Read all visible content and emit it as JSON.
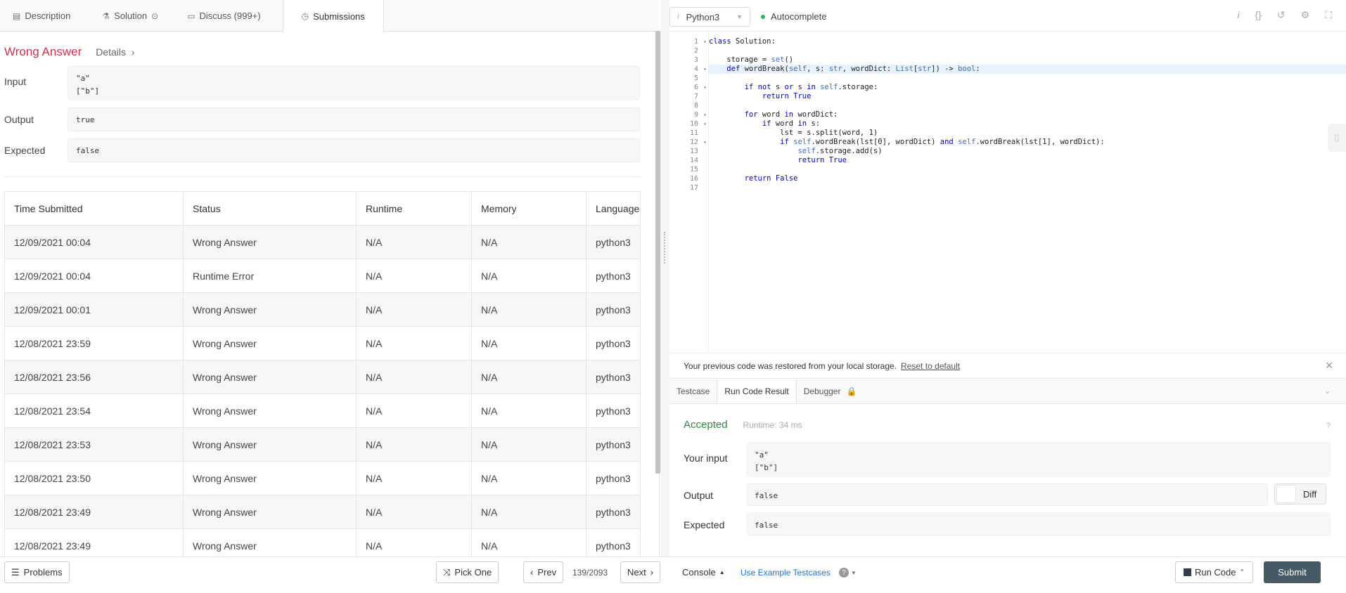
{
  "tabs": [
    {
      "label": "Description",
      "icon": "document-icon"
    },
    {
      "label": "Solution",
      "icon": "flask-icon",
      "extra": "play-circle-icon"
    },
    {
      "label": "Discuss (999+)",
      "icon": "chat-icon"
    },
    {
      "label": "Submissions",
      "icon": "clock-icon",
      "active": true
    }
  ],
  "result": {
    "title": "Wrong Answer",
    "details": "Details",
    "input_label": "Input",
    "input_lines": [
      "\"a\"",
      "[\"b\"]"
    ],
    "output_label": "Output",
    "output_value": "true",
    "expected_label": "Expected",
    "expected_value": "false"
  },
  "submissions": {
    "headers": [
      "Time Submitted",
      "Status",
      "Runtime",
      "Memory",
      "Language"
    ],
    "rows": [
      {
        "time": "12/09/2021 00:04",
        "status": "Wrong Answer",
        "runtime": "N/A",
        "memory": "N/A",
        "lang": "python3"
      },
      {
        "time": "12/09/2021 00:04",
        "status": "Runtime Error",
        "runtime": "N/A",
        "memory": "N/A",
        "lang": "python3"
      },
      {
        "time": "12/09/2021 00:01",
        "status": "Wrong Answer",
        "runtime": "N/A",
        "memory": "N/A",
        "lang": "python3"
      },
      {
        "time": "12/08/2021 23:59",
        "status": "Wrong Answer",
        "runtime": "N/A",
        "memory": "N/A",
        "lang": "python3"
      },
      {
        "time": "12/08/2021 23:56",
        "status": "Wrong Answer",
        "runtime": "N/A",
        "memory": "N/A",
        "lang": "python3"
      },
      {
        "time": "12/08/2021 23:54",
        "status": "Wrong Answer",
        "runtime": "N/A",
        "memory": "N/A",
        "lang": "python3"
      },
      {
        "time": "12/08/2021 23:53",
        "status": "Wrong Answer",
        "runtime": "N/A",
        "memory": "N/A",
        "lang": "python3"
      },
      {
        "time": "12/08/2021 23:50",
        "status": "Wrong Answer",
        "runtime": "N/A",
        "memory": "N/A",
        "lang": "python3"
      },
      {
        "time": "12/08/2021 23:49",
        "status": "Wrong Answer",
        "runtime": "N/A",
        "memory": "N/A",
        "lang": "python3"
      },
      {
        "time": "12/08/2021 23:49",
        "status": "Wrong Answer",
        "runtime": "N/A",
        "memory": "N/A",
        "lang": "python3"
      }
    ]
  },
  "editor": {
    "language": "Python3",
    "autocomplete": "Autocomplete",
    "toolbar_icons": [
      "info-icon",
      "braces-icon",
      "reset-icon",
      "settings-icon",
      "fullscreen-icon"
    ],
    "folds": [
      1,
      4,
      6,
      9,
      10,
      12
    ],
    "current_line": 4,
    "code_lines": [
      "class Solution:",
      "",
      "    storage = set()",
      "    def wordBreak(self, s: str, wordDict: List[str]) -> bool:",
      "",
      "        if not s or s in self.storage:",
      "            return True",
      "",
      "        for word in wordDict:",
      "            if word in s:",
      "                lst = s.split(word, 1)",
      "                if self.wordBreak(lst[0], wordDict) and self.wordBreak(lst[1], wordDict):",
      "                    self.storage.add(s)",
      "                    return True",
      "",
      "        return False",
      ""
    ]
  },
  "restore_notice": {
    "text": "Your previous code was restored from your local storage.",
    "link": "Reset to default"
  },
  "console_tabs": [
    "Testcase",
    "Run Code Result",
    "Debugger"
  ],
  "run_result": {
    "status": "Accepted",
    "runtime": "Runtime: 34 ms",
    "input_label": "Your input",
    "input_lines": [
      "\"a\"",
      "[\"b\"]"
    ],
    "output_label": "Output",
    "output_value": "false",
    "expected_label": "Expected",
    "expected_value": "false",
    "diff_label": "Diff"
  },
  "bottom": {
    "problems": "Problems",
    "pick_one": "Pick One",
    "prev": "Prev",
    "page": "139/2093",
    "next": "Next",
    "console": "Console",
    "use_example": "Use Example Testcases",
    "run_code": "Run Code",
    "submit": "Submit"
  },
  "colors": {
    "wrong": "#d0324f",
    "accepted": "#2e8b3e",
    "submit_bg": "#455a64",
    "link": "#1a73e8"
  }
}
